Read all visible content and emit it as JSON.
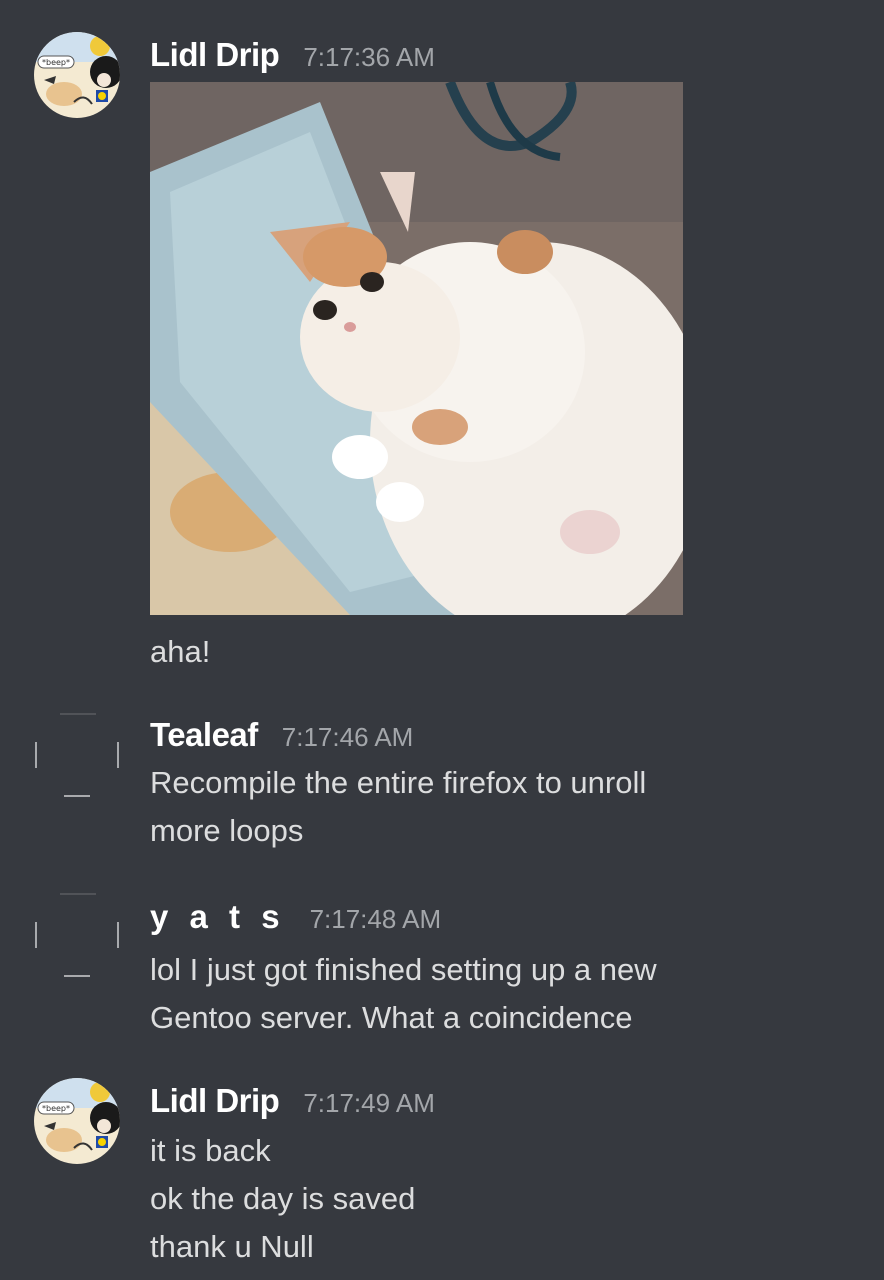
{
  "messages": [
    {
      "author": "Lidl Drip",
      "timestamp": "7:17:36 AM",
      "avatar_icon": "lidl-drip-avatar",
      "attachment_icon": "crying-cat-image",
      "avatar_text": "*beep*",
      "lines": [
        "aha!"
      ]
    },
    {
      "author": "Tealeaf",
      "timestamp": "7:17:46 AM",
      "avatar_icon": "placeholder-avatar",
      "lines": [
        "Recompile the entire firefox to unroll",
        "more loops"
      ]
    },
    {
      "author": "y a t s",
      "timestamp": "7:17:48 AM",
      "avatar_icon": "placeholder-avatar",
      "lines": [
        "lol I just got finished setting up a new",
        "Gentoo server. What a coincidence"
      ]
    },
    {
      "author": "Lidl Drip",
      "timestamp": "7:17:49 AM",
      "avatar_icon": "lidl-drip-avatar",
      "avatar_text": "*beep*",
      "lines": [
        "it is back",
        "ok the day is saved",
        "thank u Null"
      ]
    }
  ],
  "colors": {
    "background": "#36393f",
    "username": "#ffffff",
    "timestamp": "#a3a6aa",
    "message_text": "#dcddde"
  }
}
